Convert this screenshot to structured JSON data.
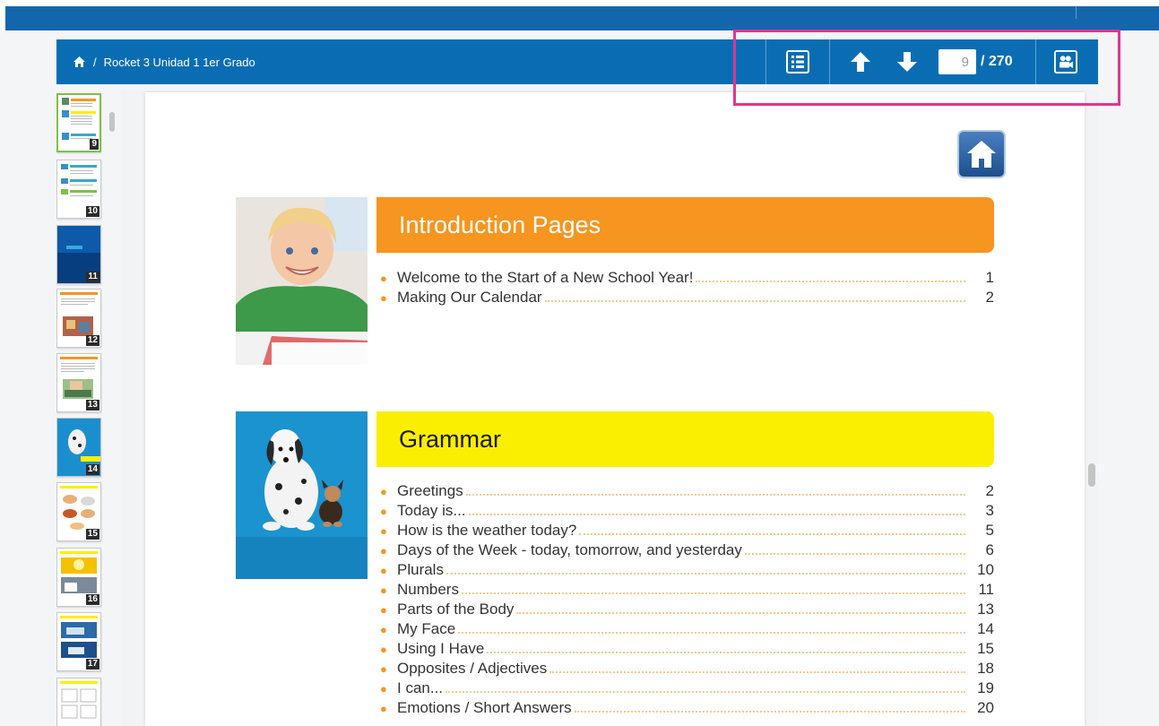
{
  "breadcrumb": {
    "separator": "/",
    "title": "Rocket 3 Unidad 1 1er Grado"
  },
  "pager": {
    "current": "9",
    "total": "/ 270"
  },
  "thumbnails": [
    {
      "num": "9"
    },
    {
      "num": "10"
    },
    {
      "num": "11"
    },
    {
      "num": "12"
    },
    {
      "num": "13"
    },
    {
      "num": "14"
    },
    {
      "num": "15"
    },
    {
      "num": "16"
    },
    {
      "num": "17"
    }
  ],
  "sections": {
    "intro": {
      "title": "Introduction Pages",
      "items": [
        {
          "title": "Welcome to the Start of a New School Year!",
          "page": "1"
        },
        {
          "title": "Making Our Calendar",
          "page": "2"
        }
      ]
    },
    "grammar": {
      "title": "Grammar",
      "items": [
        {
          "title": "Greetings",
          "page": "2"
        },
        {
          "title": "Today is...",
          "page": "3"
        },
        {
          "title": "How is the weather today?",
          "page": "5"
        },
        {
          "title": "Days of the Week - today, tomorrow, and yesterday",
          "page": "6"
        },
        {
          "title": "Plurals",
          "page": "10"
        },
        {
          "title": "Numbers",
          "page": "11"
        },
        {
          "title": "Parts of the Body",
          "page": "13"
        },
        {
          "title": "My Face",
          "page": "14"
        },
        {
          "title": "Using I Have",
          "page": "15"
        },
        {
          "title": "Opposites / Adjectives",
          "page": "18"
        },
        {
          "title": "I can...",
          "page": "19"
        },
        {
          "title": "Emotions / Short Answers",
          "page": "20"
        }
      ]
    }
  },
  "colors": {
    "header": "#0a6db4",
    "highlight": "#e8318f",
    "intro_bar": "#f69520",
    "grammar_bar": "#fbef00",
    "thumb_selected": "#7dc242"
  }
}
